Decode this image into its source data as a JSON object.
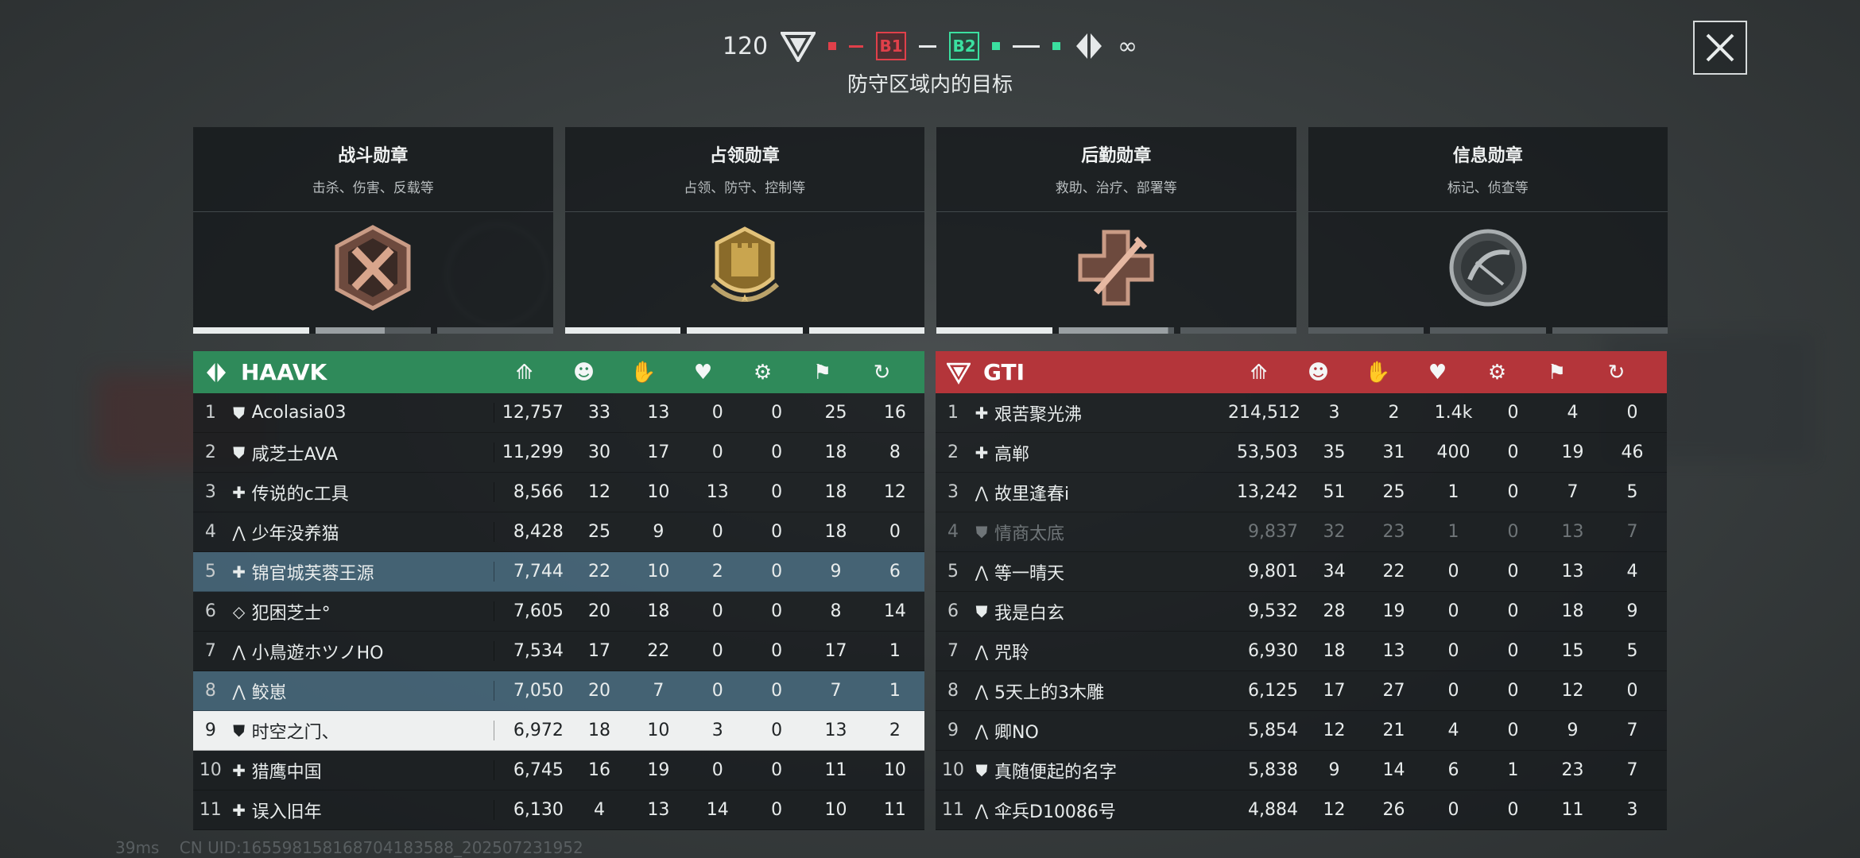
{
  "top": {
    "timer": "120",
    "objective_b1": "B1",
    "objective_b2": "B2",
    "tickets": "∞",
    "subtitle": "防守区域内的目标"
  },
  "medals": [
    {
      "title": "战斗勋章",
      "subtitle": "击杀、伤害、反载等",
      "icon": "combat-medal-icon",
      "progress": [
        1.0,
        0.6,
        0.0
      ]
    },
    {
      "title": "占领勋章",
      "subtitle": "占领、防守、控制等",
      "icon": "capture-medal-icon",
      "progress": [
        1.0,
        1.0,
        1.0
      ]
    },
    {
      "title": "后勤勋章",
      "subtitle": "救助、治疗、部署等",
      "icon": "support-medal-icon",
      "progress": [
        1.0,
        0.95,
        0.0
      ]
    },
    {
      "title": "信息勋章",
      "subtitle": "标记、侦查等",
      "icon": "recon-medal-icon",
      "progress": [
        0.0,
        0.0,
        0.0
      ]
    }
  ],
  "team_left": {
    "name": "HAAVK",
    "color": "#2f8a5a",
    "players": [
      {
        "rank": "1",
        "cls": "⛊",
        "name": "Acolasia03",
        "score": "12,757",
        "kills": "33",
        "assists": "13",
        "revives": "0",
        "vehicle": "0",
        "capture": "25",
        "deaths": "16"
      },
      {
        "rank": "2",
        "cls": "⛊",
        "name": "咸芝士AVA",
        "score": "11,299",
        "kills": "30",
        "assists": "17",
        "revives": "0",
        "vehicle": "0",
        "capture": "18",
        "deaths": "8"
      },
      {
        "rank": "3",
        "cls": "✚",
        "name": "传说的c工具",
        "score": "8,566",
        "kills": "12",
        "assists": "10",
        "revives": "13",
        "vehicle": "0",
        "capture": "18",
        "deaths": "12"
      },
      {
        "rank": "4",
        "cls": "⋀",
        "name": "少年没养猫",
        "score": "8,428",
        "kills": "25",
        "assists": "9",
        "revives": "0",
        "vehicle": "0",
        "capture": "18",
        "deaths": "0"
      },
      {
        "rank": "5",
        "cls": "✚",
        "name": "锦官城芙蓉王源",
        "score": "7,744",
        "kills": "22",
        "assists": "10",
        "revives": "2",
        "vehicle": "0",
        "capture": "9",
        "deaths": "6",
        "style": "hl"
      },
      {
        "rank": "6",
        "cls": "◇",
        "name": "犯困芝士°",
        "score": "7,605",
        "kills": "20",
        "assists": "18",
        "revives": "0",
        "vehicle": "0",
        "capture": "8",
        "deaths": "14"
      },
      {
        "rank": "7",
        "cls": "⋀",
        "name": "小鳥遊ホツノHO",
        "score": "7,534",
        "kills": "17",
        "assists": "22",
        "revives": "0",
        "vehicle": "0",
        "capture": "17",
        "deaths": "1"
      },
      {
        "rank": "8",
        "cls": "⋀",
        "name": "鲛崽",
        "score": "7,050",
        "kills": "20",
        "assists": "7",
        "revives": "0",
        "vehicle": "0",
        "capture": "7",
        "deaths": "1",
        "style": "hl"
      },
      {
        "rank": "9",
        "cls": "⛊",
        "name": "时空之门、",
        "score": "6,972",
        "kills": "18",
        "assists": "10",
        "revives": "3",
        "vehicle": "0",
        "capture": "13",
        "deaths": "2",
        "style": "me"
      },
      {
        "rank": "10",
        "cls": "✚",
        "name": "猎鹰中国",
        "score": "6,745",
        "kills": "16",
        "assists": "19",
        "revives": "0",
        "vehicle": "0",
        "capture": "11",
        "deaths": "10"
      },
      {
        "rank": "11",
        "cls": "✚",
        "name": "误入旧年",
        "score": "6,130",
        "kills": "4",
        "assists": "13",
        "revives": "14",
        "vehicle": "0",
        "capture": "10",
        "deaths": "11"
      }
    ]
  },
  "team_right": {
    "name": "GTI",
    "color": "#b4353a",
    "players": [
      {
        "rank": "1",
        "cls": "✚",
        "name": "艰苦聚光沸",
        "score": "214,512",
        "kills": "3",
        "assists": "2",
        "revives": "1.4k",
        "vehicle": "0",
        "capture": "4",
        "deaths": "0"
      },
      {
        "rank": "2",
        "cls": "✚",
        "name": "高郸",
        "score": "53,503",
        "kills": "35",
        "assists": "31",
        "revives": "400",
        "vehicle": "0",
        "capture": "19",
        "deaths": "46"
      },
      {
        "rank": "3",
        "cls": "⋀",
        "name": "故里逢春i",
        "score": "13,242",
        "kills": "51",
        "assists": "25",
        "revives": "1",
        "vehicle": "0",
        "capture": "7",
        "deaths": "5"
      },
      {
        "rank": "4",
        "cls": "⛊",
        "name": "情商太底",
        "score": "9,837",
        "kills": "32",
        "assists": "23",
        "revives": "1",
        "vehicle": "0",
        "capture": "13",
        "deaths": "7",
        "style": "dim"
      },
      {
        "rank": "5",
        "cls": "⋀",
        "name": "等一晴天",
        "score": "9,801",
        "kills": "34",
        "assists": "22",
        "revives": "0",
        "vehicle": "0",
        "capture": "13",
        "deaths": "4"
      },
      {
        "rank": "6",
        "cls": "⛊",
        "name": "我是白玄",
        "score": "9,532",
        "kills": "28",
        "assists": "19",
        "revives": "0",
        "vehicle": "0",
        "capture": "18",
        "deaths": "9"
      },
      {
        "rank": "7",
        "cls": "⋀",
        "name": "咒聆",
        "score": "6,930",
        "kills": "18",
        "assists": "13",
        "revives": "0",
        "vehicle": "0",
        "capture": "15",
        "deaths": "5"
      },
      {
        "rank": "8",
        "cls": "⋀",
        "name": "5天上的3木雕",
        "score": "6,125",
        "kills": "17",
        "assists": "27",
        "revives": "0",
        "vehicle": "0",
        "capture": "12",
        "deaths": "0"
      },
      {
        "rank": "9",
        "cls": "⋀",
        "name": "卿NO",
        "score": "5,854",
        "kills": "12",
        "assists": "21",
        "revives": "4",
        "vehicle": "0",
        "capture": "9",
        "deaths": "7"
      },
      {
        "rank": "10",
        "cls": "⛊",
        "name": "真随便起的名字",
        "score": "5,838",
        "kills": "9",
        "assists": "14",
        "revives": "6",
        "vehicle": "1",
        "capture": "23",
        "deaths": "7"
      },
      {
        "rank": "11",
        "cls": "⋀",
        "name": "伞兵D10086号",
        "score": "4,884",
        "kills": "12",
        "assists": "26",
        "revives": "0",
        "vehicle": "0",
        "capture": "11",
        "deaths": "3"
      }
    ]
  },
  "columns": [
    "score-icon",
    "kills-icon",
    "assists-icon",
    "revives-icon",
    "vehicle-icon",
    "capture-icon",
    "deaths-icon"
  ],
  "status": {
    "ping": "39ms",
    "uid": "CN UID:1655981581687041835​88_202507231952"
  }
}
